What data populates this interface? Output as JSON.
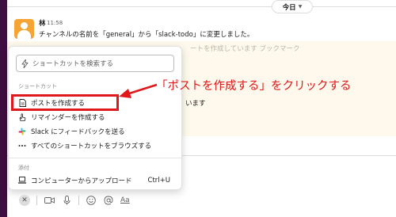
{
  "date_divider": {
    "label": "今日"
  },
  "message": {
    "author": "林",
    "time": "11:58",
    "text": "チャンネルの名前を「general」から「slack-todo」に変更しました。"
  },
  "background": {
    "faded_line": "ートを作成しています ブックマーク",
    "partial_text": "います"
  },
  "shortcut_menu": {
    "search_placeholder": "ショートカットを検索する",
    "section_shortcuts": "ショートカット",
    "items": [
      {
        "label": "ポストを作成する",
        "icon": "document-icon"
      },
      {
        "label": "リマインダーを作成する",
        "icon": "hand-icon"
      },
      {
        "label": "Slack にフィードバックを送る",
        "icon": "slack-logo-icon"
      },
      {
        "label": "すべてのショートカットをブラウズする",
        "icon": "ellipsis-icon"
      }
    ],
    "section_attach": "添付",
    "attach_item": {
      "label": "コンピューターからアップロード",
      "shortcut": "Ctrl+U",
      "icon": "laptop-icon"
    }
  },
  "annotation": {
    "text": "「ポストを作成する」をクリックする",
    "color": "#e0181b"
  },
  "toolbar": {
    "format_label": "Aa"
  },
  "colors": {
    "sidebar": "#3f0e40",
    "avatar": "#f6a434",
    "highlight": "#fef9ec"
  }
}
